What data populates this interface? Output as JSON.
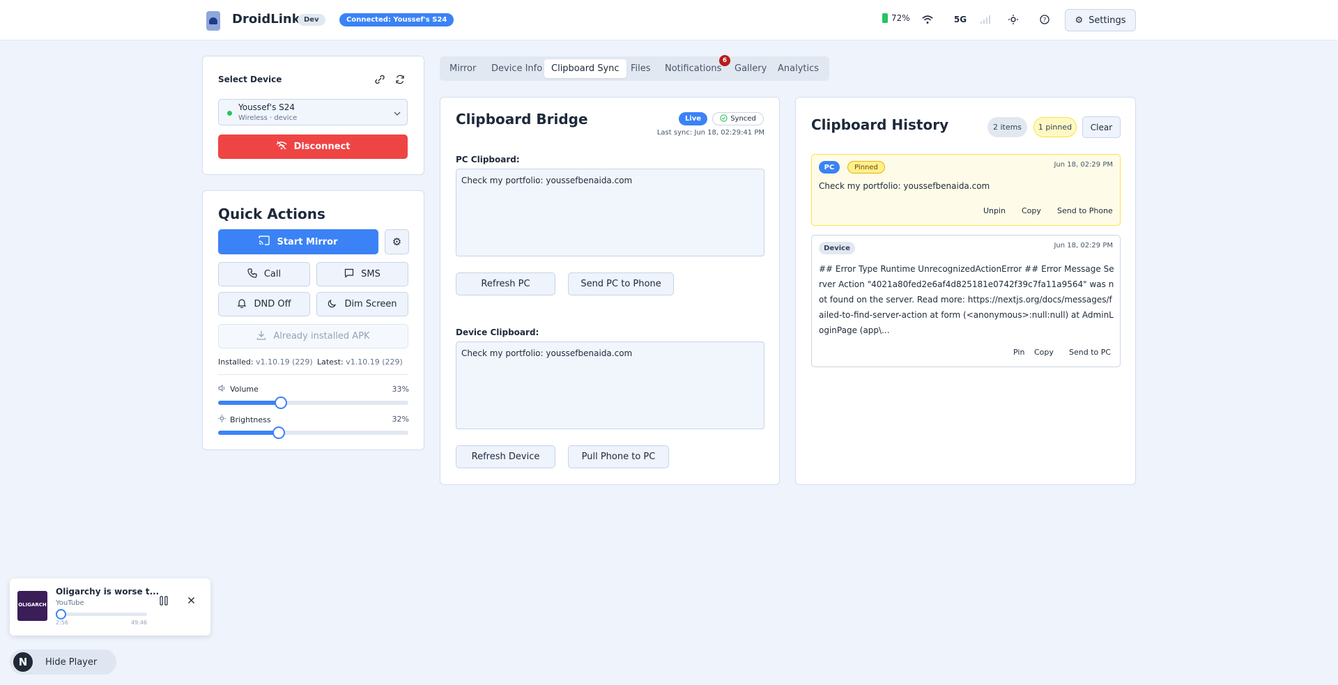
{
  "header": {
    "brand": "DroidLink",
    "dev_badge": "Dev",
    "connection_badge": "Connected: Youssef's S24",
    "battery_percent": "72%",
    "network_label": "5G",
    "settings_label": "Settings"
  },
  "device_panel": {
    "title": "Select Device",
    "device_name": "Youssef's S24",
    "device_sub": "Wireless · device",
    "disconnect_label": "Disconnect"
  },
  "quick_actions": {
    "title": "Quick Actions",
    "start_mirror": "Start Mirror",
    "call": "Call",
    "sms": "SMS",
    "dnd": "DND Off",
    "dim_screen": "Dim Screen",
    "apk_button": "Already installed APK",
    "installed_label": "Installed:",
    "installed_version": "v1.10.19 (229)",
    "latest_label": "Latest:",
    "latest_version": "v1.10.19 (229)",
    "volume_label": "Volume",
    "volume_value": "33%",
    "volume_fraction": 0.33,
    "brightness_label": "Brightness",
    "brightness_value": "32%",
    "brightness_fraction": 0.32
  },
  "tabs": [
    {
      "label": "Mirror"
    },
    {
      "label": "Device Info"
    },
    {
      "label": "Clipboard Sync"
    },
    {
      "label": "Files"
    },
    {
      "label": "Notifications"
    },
    {
      "label": "Gallery"
    },
    {
      "label": "Analytics"
    }
  ],
  "notifications_count": "6",
  "bridge": {
    "title": "Clipboard Bridge",
    "live_badge": "Live",
    "synced_badge": "Synced",
    "last_sync": "Last sync: Jun 18, 02:29:41 PM",
    "pc_label": "PC Clipboard:",
    "pc_text": "Check my portfolio: youssefbenaida.com",
    "refresh_pc": "Refresh PC",
    "send_pc": "Send PC to Phone",
    "device_label": "Device Clipboard:",
    "device_text": "Check my portfolio: youssefbenaida.com",
    "refresh_device": "Refresh Device",
    "pull_phone": "Pull Phone to PC"
  },
  "history": {
    "title": "Clipboard History",
    "count_badge": "2 items",
    "pinned_badge": "1 pinned",
    "clear_label": "Clear",
    "items": [
      {
        "source": "PC",
        "tag": "Pinned",
        "time": "Jun 18, 02:29 PM",
        "text": "Check my portfolio: youssefbenaida.com",
        "actions": [
          "Unpin",
          "Copy",
          "Send to Phone"
        ]
      },
      {
        "source": "Device",
        "time": "Jun 18, 02:29 PM",
        "text": "## Error Type Runtime UnrecognizedActionError ## Error Message Server Action \"4021a80fed2e6af4d825181e0742f39c7fa11a9564\" was not found on the server. Read more: https://nextjs.org/docs/messages/failed-to-find-server-action at form (<anonymous>:null:null) at AdminLoginPage (app\\...",
        "actions": [
          "Pin",
          "Copy",
          "Send to PC"
        ]
      }
    ]
  },
  "player": {
    "title": "Oligarchy is worse t...",
    "source": "YouTube",
    "elapsed": "2:56",
    "duration": "49:46",
    "progress_fraction": 0.06,
    "thumb_text": "OLIGARCH",
    "hide_label": "Hide Player",
    "avatar_letter": "N"
  }
}
